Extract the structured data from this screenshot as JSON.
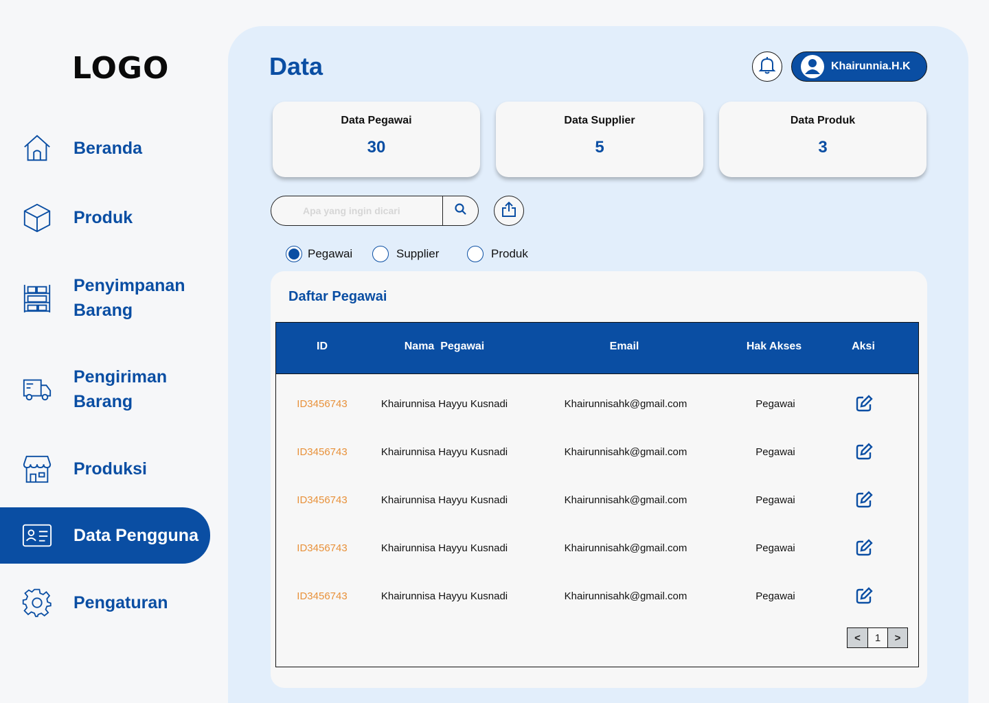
{
  "logo": "LOGO",
  "sidebar": {
    "items": [
      {
        "label": "Beranda",
        "icon": "home-icon"
      },
      {
        "label": "Produk",
        "icon": "box-icon"
      },
      {
        "label": "Penyimpanan Barang",
        "line1": "Penyimpanan",
        "line2": "Barang",
        "icon": "warehouse-shelf-icon"
      },
      {
        "label": "Pengiriman Barang",
        "line1": "Pengiriman",
        "line2": "Barang",
        "icon": "delivery-truck-icon"
      },
      {
        "label": "Produksi",
        "icon": "store-icon"
      },
      {
        "label": "Data Pengguna",
        "icon": "id-card-icon",
        "active": true
      },
      {
        "label": "Pengaturan",
        "icon": "gear-icon"
      }
    ]
  },
  "header": {
    "title": "Data",
    "user_name": "Khairunnia.H.K"
  },
  "stats": [
    {
      "title": "Data Pegawai",
      "value": "30"
    },
    {
      "title": "Data Supplier",
      "value": "5"
    },
    {
      "title": "Data Produk",
      "value": "3"
    }
  ],
  "search": {
    "placeholder": "Apa yang ingin dicari",
    "value": ""
  },
  "filters": {
    "options": [
      "Pegawai",
      "Supplier",
      "Produk"
    ],
    "selected": "Pegawai"
  },
  "table": {
    "title": "Daftar Pegawai",
    "columns": [
      "ID",
      "Nama  Pegawai",
      "Email",
      "Hak Akses",
      "Aksi"
    ],
    "rows": [
      {
        "id": "ID3456743",
        "name": "Khairunnisa Hayyu Kusnadi",
        "email": "Khairunnisahk@gmail.com",
        "access": "Pegawai"
      },
      {
        "id": "ID3456743",
        "name": "Khairunnisa Hayyu Kusnadi",
        "email": "Khairunnisahk@gmail.com",
        "access": "Pegawai"
      },
      {
        "id": "ID3456743",
        "name": "Khairunnisa Hayyu Kusnadi",
        "email": "Khairunnisahk@gmail.com",
        "access": "Pegawai"
      },
      {
        "id": "ID3456743",
        "name": "Khairunnisa Hayyu Kusnadi",
        "email": "Khairunnisahk@gmail.com",
        "access": "Pegawai"
      },
      {
        "id": "ID3456743",
        "name": "Khairunnisa Hayyu Kusnadi",
        "email": "Khairunnisahk@gmail.com",
        "access": "Pegawai"
      }
    ],
    "pagination": {
      "prev": "<",
      "page": "1",
      "next": ">"
    }
  },
  "colors": {
    "primary": "#0a4ea3",
    "panel": "#e2eefb",
    "id_text": "#e8913a"
  }
}
